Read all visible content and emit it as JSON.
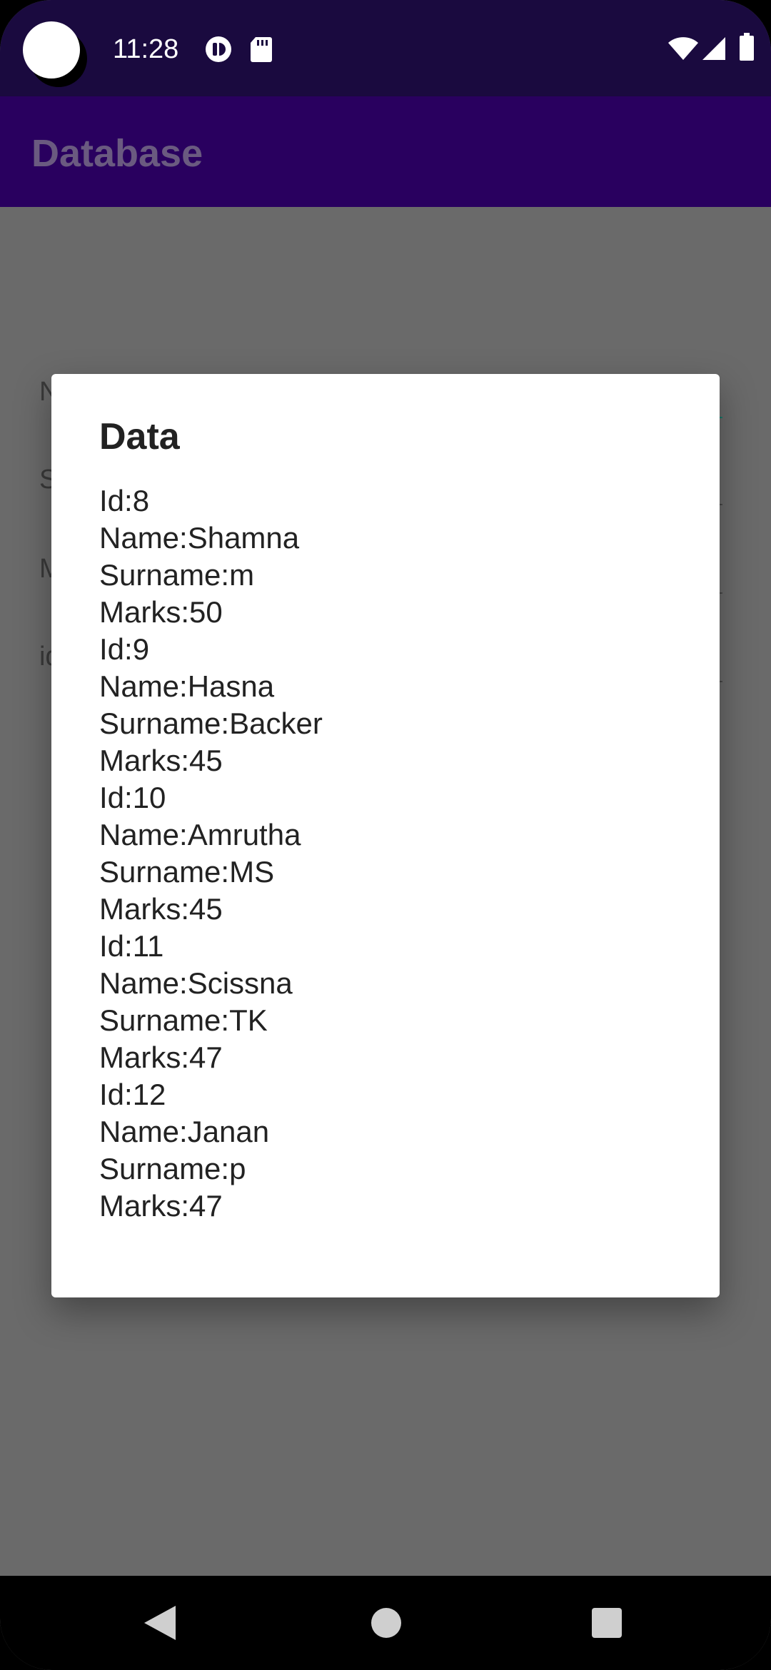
{
  "status_bar": {
    "time": "11:28",
    "icons": [
      "sync-icon",
      "sd-card-icon",
      "wifi-icon",
      "signal-icon",
      "battery-icon"
    ]
  },
  "app_bar": {
    "title": "Database"
  },
  "background_form": {
    "partial_labels": [
      "N",
      "S",
      "M",
      "id"
    ]
  },
  "dialog": {
    "title": "Data",
    "lines": [
      "Id:8",
      "Name:Shamna",
      "Surname:m",
      "Marks:50",
      "Id:9",
      "Name:Hasna",
      "Surname:Backer",
      "Marks:45",
      "Id:10",
      "Name:Amrutha",
      "Surname:MS",
      "Marks:45",
      "Id:11",
      "Name:Scissna",
      "Surname:TK",
      "Marks:47",
      "Id:12",
      "Name:Janan",
      "Surname:p",
      "Marks:47"
    ]
  },
  "nav_bar": {
    "buttons": [
      "back-icon",
      "home-icon",
      "recents-icon"
    ]
  },
  "colors": {
    "status_bar": "#1a0a3f",
    "app_bar": "#29005f",
    "scrim": "#6a6a6a",
    "dialog_bg": "#ffffff",
    "text": "#222222"
  }
}
